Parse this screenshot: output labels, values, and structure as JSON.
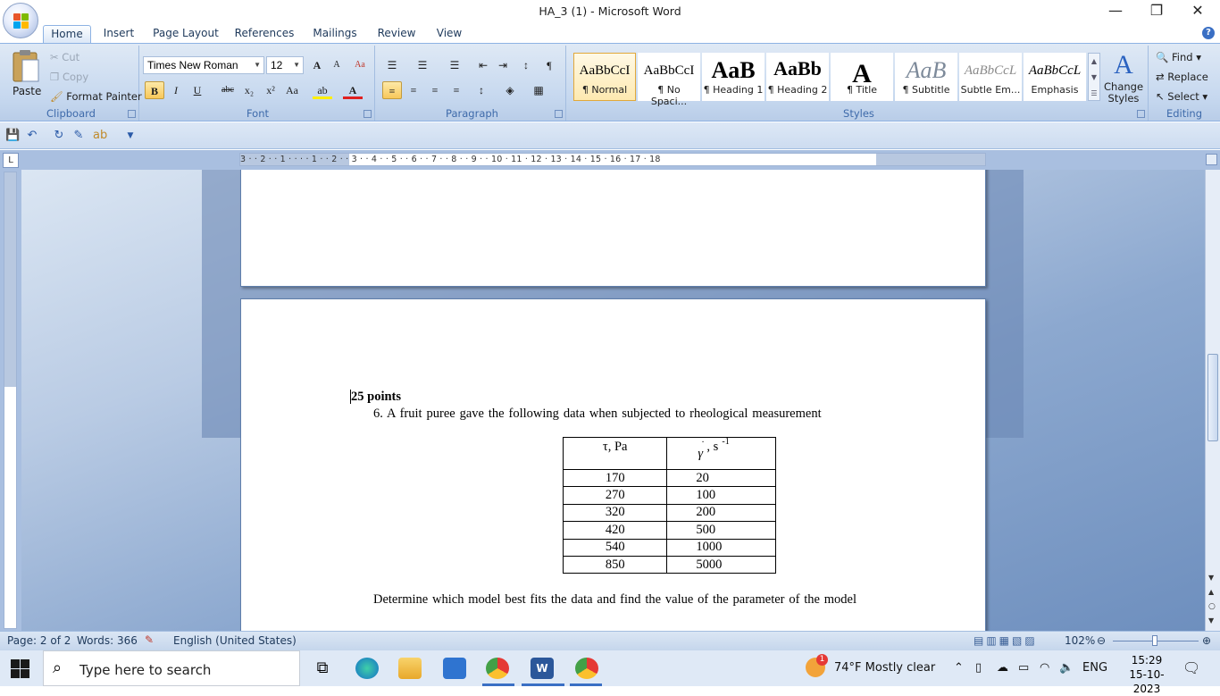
{
  "window": {
    "title": "HA_3 (1) - Microsoft Word",
    "minimize": "—",
    "restore": "❐",
    "close": "✕",
    "help": "?"
  },
  "ribbon_tabs": [
    "Home",
    "Insert",
    "Page Layout",
    "References",
    "Mailings",
    "Review",
    "View"
  ],
  "clipboard": {
    "paste": "Paste",
    "cut": "Cut",
    "copy": "Copy",
    "format_painter": "Format Painter",
    "label": "Clipboard"
  },
  "font": {
    "family": "Times New Roman",
    "size": "12",
    "label": "Font",
    "bold": "B",
    "italic": "I",
    "underline": "U",
    "strike": "abc",
    "subscript": "x₂",
    "superscript": "x²",
    "change_case": "Aa",
    "grow": "A",
    "shrink": "A"
  },
  "paragraph": {
    "label": "Paragraph"
  },
  "styles": {
    "label": "Styles",
    "items": [
      {
        "sample": "AaBbCcI",
        "name": "¶ Normal"
      },
      {
        "sample": "AaBbCcI",
        "name": "¶ No Spaci..."
      },
      {
        "sample": "AaB",
        "name": "¶ Heading 1"
      },
      {
        "sample": "AaBb",
        "name": "¶ Heading 2"
      },
      {
        "sample": "A",
        "name": "¶ Title"
      },
      {
        "sample": "AaB",
        "name": "¶ Subtitle"
      },
      {
        "sample": "AaBbCcL",
        "name": "Subtle Em..."
      },
      {
        "sample": "AaBbCcL",
        "name": "Emphasis"
      }
    ],
    "change_styles": "Change Styles"
  },
  "editing": {
    "label": "Editing",
    "find": "Find",
    "replace": "Replace",
    "select": "Select"
  },
  "ruler": {
    "numbers": "3 · · 2 · · 1 · · · · 1 · · 2 · · 3 · · 4 · · 5 · · 6 · · 7 · · 8 · · 9 · · 10 · 11 · 12 · 13 · 14 · 15 · 16 · 17 · 18"
  },
  "document": {
    "points": "25 points",
    "question": "6. A fruit puree gave the following data when subjected to rheological measurement",
    "table_headers": {
      "col1": "τ, Pa",
      "col2_symbol": "γ",
      "col2_unit": ", s",
      "col2_exp": "-1"
    },
    "table_rows": [
      [
        "170",
        "20"
      ],
      [
        "270",
        "100"
      ],
      [
        "320",
        "200"
      ],
      [
        "420",
        "500"
      ],
      [
        "540",
        "1000"
      ],
      [
        "850",
        "5000"
      ]
    ],
    "footer_text": "Determine which model best fits the data and find the value of the parameter of the model"
  },
  "status": {
    "page": "Page: 2 of 2",
    "words": "Words: 366",
    "language": "English (United States)",
    "zoom": "102%"
  },
  "taskbar": {
    "search_placeholder": "Type here to search",
    "weather": "74°F  Mostly clear",
    "weather_badge": "1",
    "language": "ENG",
    "time": "15:29",
    "date": "15-10-2023"
  }
}
